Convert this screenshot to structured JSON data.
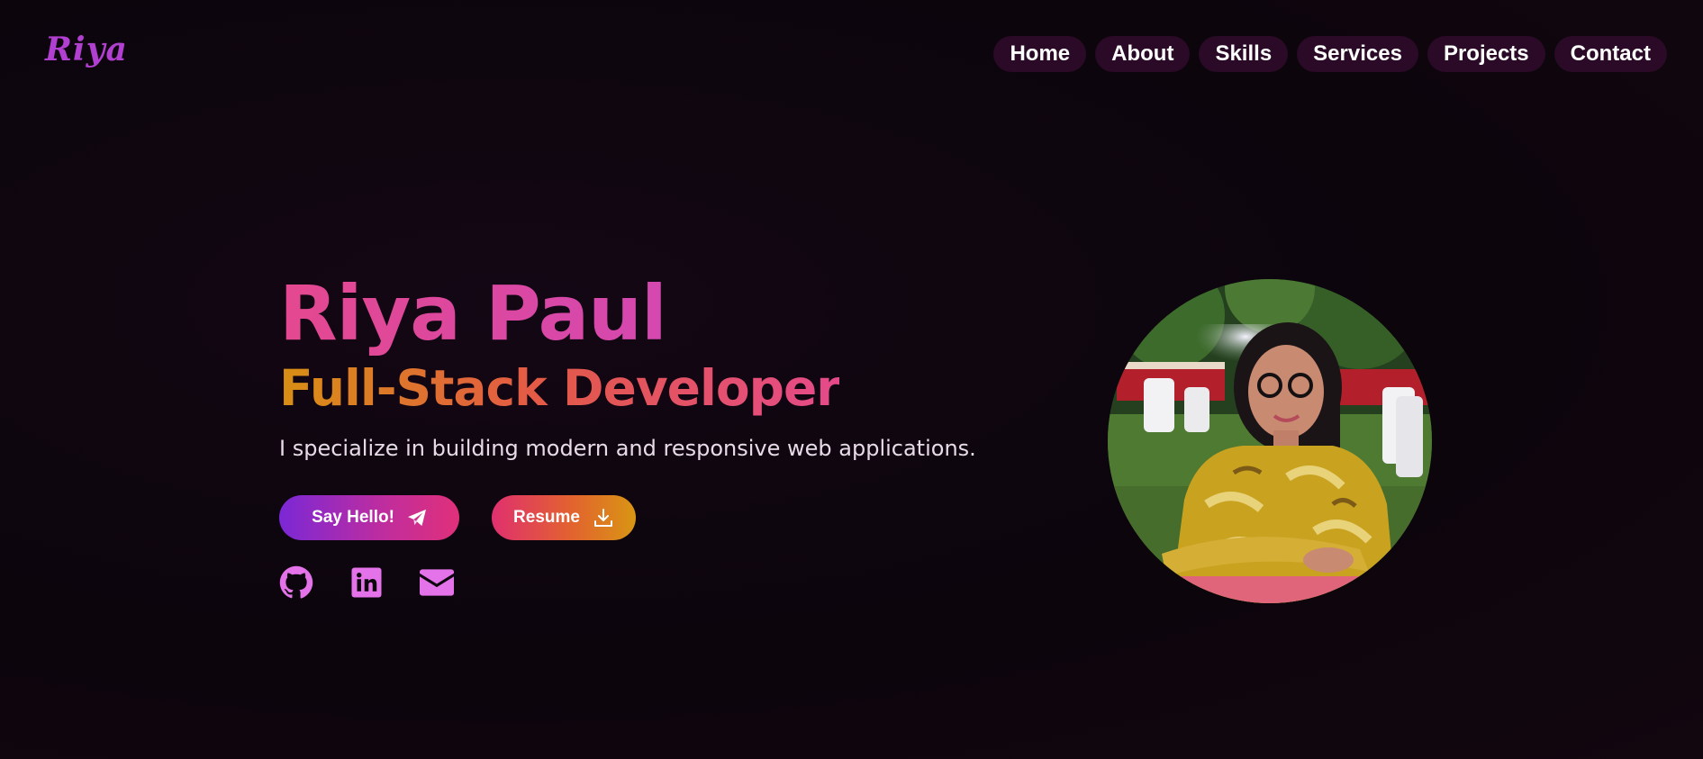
{
  "brand": {
    "logo_text": "Riya"
  },
  "nav": {
    "items": [
      {
        "label": "Home"
      },
      {
        "label": "About"
      },
      {
        "label": "Skills"
      },
      {
        "label": "Services"
      },
      {
        "label": "Projects"
      },
      {
        "label": "Contact"
      }
    ]
  },
  "hero": {
    "name": "Riya Paul",
    "role": "Full-Stack Developer",
    "tagline": "I specialize in building modern and responsive web applications.",
    "buttons": {
      "hello_label": "Say Hello!",
      "hello_icon": "paper-plane-icon",
      "resume_label": "Resume",
      "resume_icon": "download-icon"
    },
    "socials": [
      {
        "icon": "github-icon"
      },
      {
        "icon": "linkedin-icon"
      },
      {
        "icon": "envelope-icon"
      }
    ]
  },
  "profile_photo": {
    "subject": "portrait photo of woman in yellow floral dress at outdoor evening event"
  },
  "colors": {
    "background": "#0c050c",
    "nav_pill": "#2a0a26",
    "logo": "#b13fcf",
    "name_gradient": [
      "#e4488f",
      "#c648cf"
    ],
    "role_gradient": [
      "#d88f14",
      "#e35a45",
      "#e44a8a"
    ],
    "social_icon": "#e472e8"
  }
}
